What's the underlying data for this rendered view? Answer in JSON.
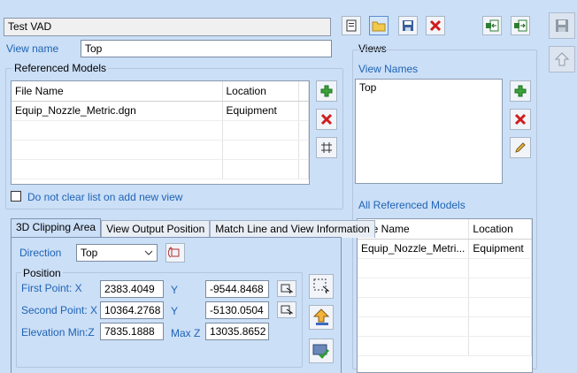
{
  "vad_name": "Test VAD",
  "view_name": {
    "label": "View name",
    "value": "Top"
  },
  "referenced_models": {
    "title": "Referenced Models",
    "columns": [
      "File Name",
      "Location"
    ],
    "rows": [
      {
        "file": "Equip_Nozzle_Metric.dgn",
        "location": "Equipment"
      }
    ]
  },
  "do_not_clear": {
    "label": "Do not clear list on add new view",
    "checked": false
  },
  "views": {
    "title": "Views",
    "names_label": "View Names",
    "items": [
      "Top"
    ]
  },
  "all_referenced_models": {
    "title": "All Referenced Models",
    "columns": [
      "File Name",
      "Location"
    ],
    "rows": [
      {
        "file": "Equip_Nozzle_Metri...",
        "location": "Equipment"
      }
    ]
  },
  "tabs": [
    "3D Clipping Area",
    "View Output Position",
    "Match Line and View Information"
  ],
  "clipping": {
    "direction_label": "Direction",
    "direction_value": "Top",
    "position_label": "Position",
    "first_point_label": "First Point: X",
    "first_x": "2383.4049",
    "y_label": "Y",
    "first_y": "-9544.8468",
    "second_point_label": "Second Point: X",
    "second_x": "10364.2768",
    "second_y": "-5130.0504",
    "elev_min_label": "Elevation Min:Z",
    "elev_min": "7835.1888",
    "max_z_label": "Max Z",
    "max_z": "13035.8652"
  },
  "colors": {
    "background": "#cbdff7",
    "label_blue": "#1f63b4",
    "add_green": "#3aa33a",
    "delete_red": "#d01c1c"
  }
}
